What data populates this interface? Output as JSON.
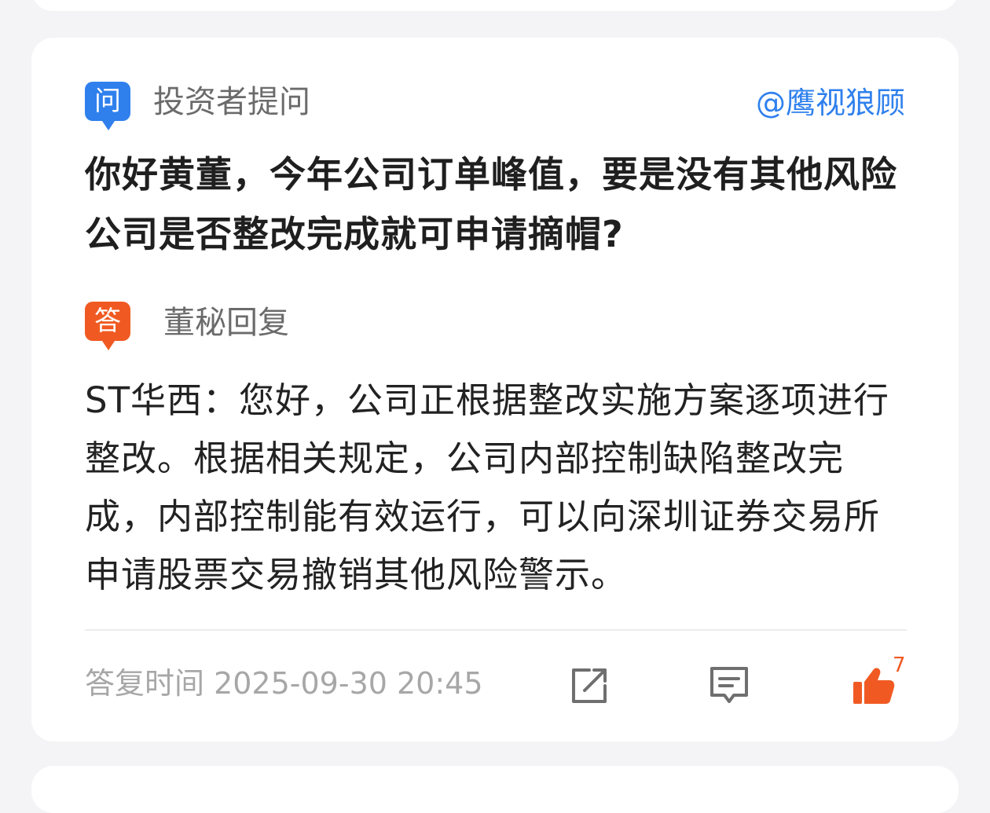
{
  "question": {
    "badge": "问",
    "label": "投资者提问",
    "asker": "@鹰视狼顾",
    "text": "你好黄董，今年公司订单峰值，要是没有其他风险公司是否整改完成就可申请摘帽?"
  },
  "answer": {
    "badge": "答",
    "label": "董秘回复",
    "text": "ST华西：您好，公司正根据整改实施方案逐项进行整改。根据相关规定，公司内部控制缺陷整改完成，内部控制能有效运行，可以向深圳证券交易所申请股票交易撤销其他风险警示。"
  },
  "footer": {
    "reply_time": "答复时间 2025-09-30 20:45",
    "like_count": "7"
  },
  "colors": {
    "question_badge": "#2f80ed",
    "answer_badge": "#f05a22",
    "like": "#f05a22",
    "asker_link": "#2f80ed"
  },
  "icons": {
    "share": "share-icon",
    "comment": "comment-icon",
    "like": "thumbs-up-icon"
  }
}
